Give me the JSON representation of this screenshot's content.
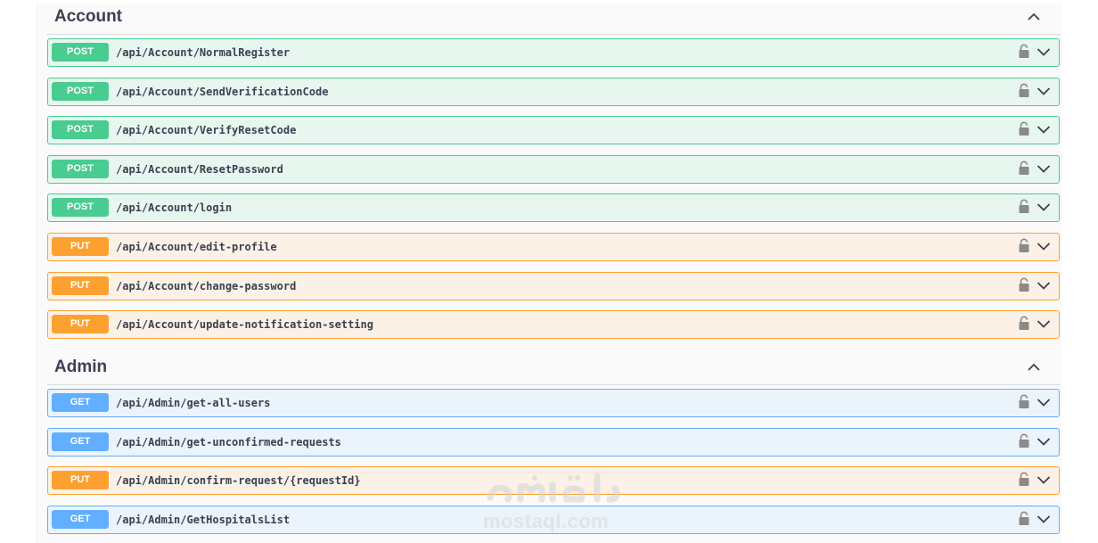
{
  "sections": [
    {
      "title": "Account",
      "operations": [
        {
          "method": "POST",
          "path": "/api/Account/NormalRegister"
        },
        {
          "method": "POST",
          "path": "/api/Account/SendVerificationCode"
        },
        {
          "method": "POST",
          "path": "/api/Account/VerifyResetCode"
        },
        {
          "method": "POST",
          "path": "/api/Account/ResetPassword"
        },
        {
          "method": "POST",
          "path": "/api/Account/login"
        },
        {
          "method": "PUT",
          "path": "/api/Account/edit-profile"
        },
        {
          "method": "PUT",
          "path": "/api/Account/change-password"
        },
        {
          "method": "PUT",
          "path": "/api/Account/update-notification-setting"
        }
      ]
    },
    {
      "title": "Admin",
      "operations": [
        {
          "method": "GET",
          "path": "/api/Admin/get-all-users"
        },
        {
          "method": "GET",
          "path": "/api/Admin/get-unconfirmed-requests"
        },
        {
          "method": "PUT",
          "path": "/api/Admin/confirm-request/{requestId}"
        },
        {
          "method": "GET",
          "path": "/api/Admin/GetHospitalsList"
        }
      ]
    }
  ],
  "watermark": {
    "arabic": "مستقل",
    "latin": "mostaql.com"
  },
  "colors": {
    "post": "#49cc90",
    "put": "#fca130",
    "get": "#61affe",
    "text": "#3b4151"
  },
  "icons": {
    "section_toggle": "chevron-up-icon",
    "lock": "lock-icon",
    "expand": "chevron-down-icon"
  }
}
